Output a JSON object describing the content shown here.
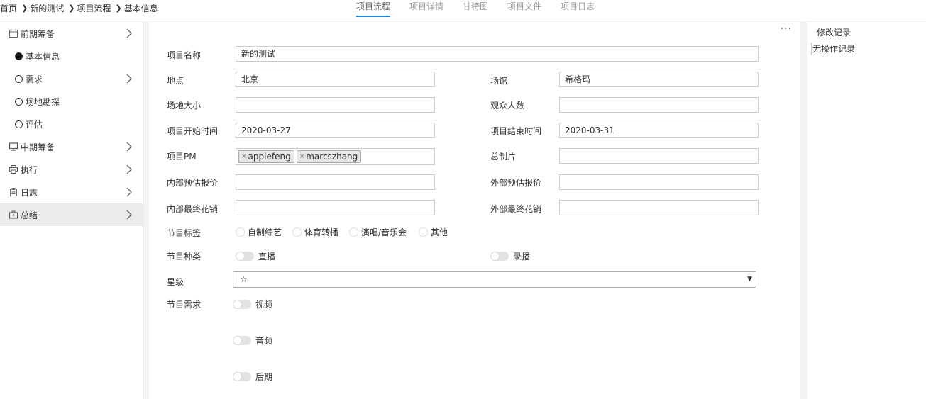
{
  "breadcrumb": {
    "items": [
      "首页",
      "新的测试",
      "项目流程",
      "基本信息"
    ]
  },
  "tabs": [
    "项目流程",
    "项目详情",
    "甘特图",
    "项目文件",
    "项目日志"
  ],
  "sidebar": {
    "items": [
      {
        "label": "前期筹备",
        "icon": "calendar-icon"
      },
      {
        "label": "基本信息"
      },
      {
        "label": "需求"
      },
      {
        "label": "场地勘探"
      },
      {
        "label": "评估"
      },
      {
        "label": "中期筹备",
        "icon": "monitor-icon"
      },
      {
        "label": "执行",
        "icon": "printer-icon"
      },
      {
        "label": "日志",
        "icon": "clipboard-icon"
      },
      {
        "label": "总结",
        "icon": "briefcase-icon"
      }
    ]
  },
  "form": {
    "more": "···",
    "name_label": "项目名称",
    "name_value": "新的测试",
    "location_label": "地点",
    "location_value": "北京",
    "venue_label": "场馆",
    "venue_value": "希格玛",
    "size_label": "场地大小",
    "size_value": "",
    "audience_label": "观众人数",
    "audience_value": "",
    "start_label": "项目开始时间",
    "start_value": "2020-03-27",
    "end_label": "项目结束时间",
    "end_value": "2020-03-31",
    "pm_label": "项目PM",
    "pm_tags": [
      "applefeng",
      "marcszhang"
    ],
    "tag_remove": "×",
    "producer_label": "总制片",
    "producer_value": "",
    "internal_est_label": "内部预估报价",
    "internal_est_value": "",
    "external_est_label": "外部预估报价",
    "external_est_value": "",
    "internal_final_label": "内部最终花销",
    "internal_final_value": "",
    "external_final_label": "外部最终花销",
    "external_final_value": "",
    "tag_label": "节目标签",
    "tag_options": [
      "自制综艺",
      "体育转播",
      "演唱/音乐会",
      "其他"
    ],
    "type_label": "节目种类",
    "type_live": "直播",
    "type_record": "录播",
    "star_label": "星级",
    "star_value": "☆",
    "star_arrow": "▼",
    "needs_label": "节目需求",
    "needs_options": [
      "视频",
      "音频",
      "后期"
    ]
  },
  "history": {
    "title": "修改记录",
    "empty": "无操作记录"
  },
  "colors": {
    "accent": "#1e88e5",
    "selected_bg": "#ebebeb",
    "page_bg": "#f2f2f2"
  }
}
